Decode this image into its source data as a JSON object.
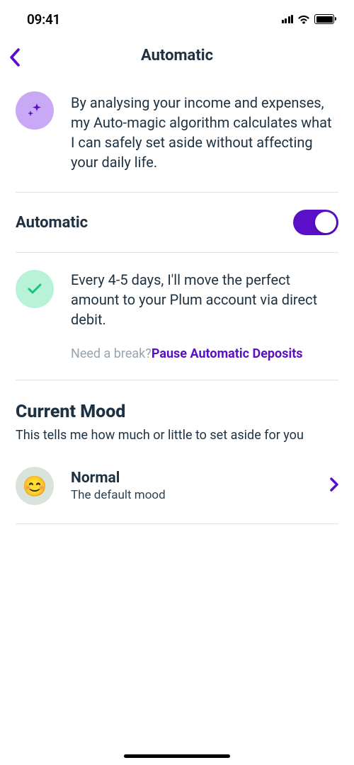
{
  "status_bar": {
    "time": "09:41"
  },
  "header": {
    "title": "Automatic"
  },
  "intro": {
    "text": "By analysing your income and expenses, my Auto-magic algorithm calculates what I can safely set aside without affecting your daily life."
  },
  "toggle": {
    "label": "Automatic",
    "enabled": true
  },
  "frequency": {
    "text": "Every 4-5 days, I'll move the perfect amount to your Plum account via direct debit.",
    "pause_prompt": "Need a break?",
    "pause_link": "Pause Automatic Deposits"
  },
  "mood_section": {
    "title": "Current Mood",
    "subtitle": "This tells me how much or little to set aside for you"
  },
  "mood_item": {
    "emoji": "😊",
    "name": "Normal",
    "description": "The default mood"
  },
  "colors": {
    "accent": "#5A0FC8",
    "text_primary": "#1d3142"
  }
}
